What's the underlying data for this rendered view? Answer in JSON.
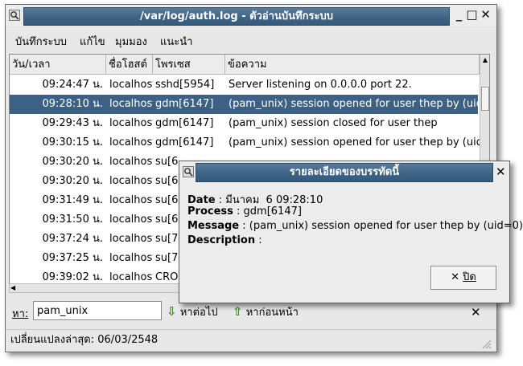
{
  "window": {
    "title": "/var/log/auth.log - ตัวอ่านบันทึกระบบ",
    "minimize": "_",
    "maximize": "□",
    "close": "✕"
  },
  "menu": [
    {
      "label": "บันทึกระบบ"
    },
    {
      "label": "แก้ไข"
    },
    {
      "label": "มุมมอง"
    },
    {
      "label": "แนะนำ"
    }
  ],
  "table": {
    "columns": [
      "วัน/เวลา",
      "ชื่อโฮสต์",
      "โพรเซส",
      "ข้อความ"
    ],
    "rows": [
      {
        "time": "09:24:47 น.",
        "host": "localhost",
        "process": "sshd[5954]",
        "message": "Server listening on 0.0.0.0 port 22."
      },
      {
        "time": "09:28:10 น.",
        "host": "localhost",
        "process": "gdm[6147]",
        "message": "(pam_unix) session opened for user thep by (uid="
      },
      {
        "time": "09:29:43 น.",
        "host": "localhost",
        "process": "gdm[6147]",
        "message": "(pam_unix) session closed for user thep"
      },
      {
        "time": "09:30:15 น.",
        "host": "localhost",
        "process": "gdm[6147]",
        "message": "(pam_unix) session opened for user thep by (uid="
      },
      {
        "time": "09:30:20 น.",
        "host": "localhost",
        "process": "su[6",
        "message": ""
      },
      {
        "time": "09:30:20 น.",
        "host": "localhost",
        "process": "su[6",
        "message": ""
      },
      {
        "time": "09:31:49 น.",
        "host": "localhost",
        "process": "su[6",
        "message": ""
      },
      {
        "time": "09:31:50 น.",
        "host": "localhost",
        "process": "su[6",
        "message": ""
      },
      {
        "time": "09:37:24 น.",
        "host": "localhost",
        "process": "su[7",
        "message": ""
      },
      {
        "time": "09:37:25 น.",
        "host": "localhost",
        "process": "su[7",
        "message": ""
      },
      {
        "time": "09:39:02 น.",
        "host": "localhost",
        "process": "CRO",
        "message": ""
      }
    ],
    "selected_index": 1
  },
  "find": {
    "label": "หา:",
    "value": "pam_unix",
    "next_label": "หาต่อไป",
    "prev_label": "หาก่อนหน้า",
    "close": "✕"
  },
  "status": {
    "text": "เปลี่ยนแปลงล่าสุด: 06/03/2548"
  },
  "dialog": {
    "title": "รายละเอียดของบรรทัดนี้",
    "close": "✕",
    "date_label": "Date",
    "date_value": "มีนาคม  6 09:28:10",
    "process_label": "Process",
    "process_value": "gdm[6147]",
    "message_label": "Message",
    "message_value": "(pam_unix) session opened for user thep by (uid=0)",
    "description_label": "Description",
    "description_value": "",
    "button_label": "ปิด"
  },
  "colors": {
    "accent": "#3d6184",
    "title_bar": "#3e6384",
    "find_arrow": "#3c8a2a"
  }
}
